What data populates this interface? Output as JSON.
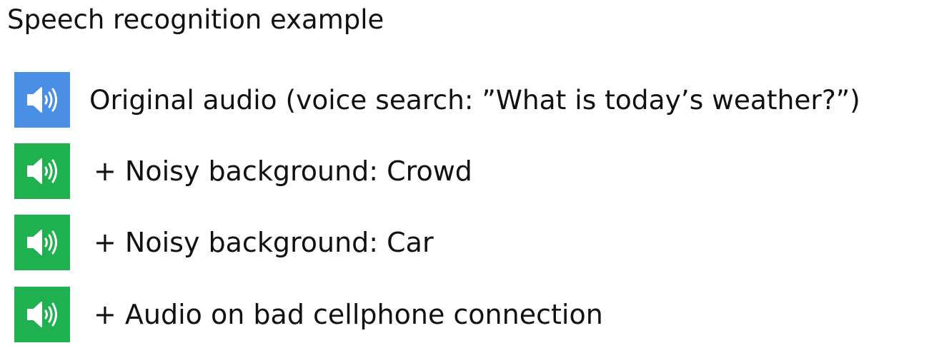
{
  "title": "Speech recognition example",
  "colors": {
    "original": "#4a8fe6",
    "augmented": "#1fb14f",
    "icon": "#ffffff"
  },
  "items": [
    {
      "icon": "speaker-icon",
      "variant": "original",
      "label": "Original audio (voice search: ”What is today’s weather?”)"
    },
    {
      "icon": "speaker-icon",
      "variant": "augmented",
      "label": "+ Noisy background: Crowd"
    },
    {
      "icon": "speaker-icon",
      "variant": "augmented",
      "label": "+ Noisy background: Car"
    },
    {
      "icon": "speaker-icon",
      "variant": "augmented",
      "label": "+ Audio on bad cellphone connection"
    }
  ]
}
